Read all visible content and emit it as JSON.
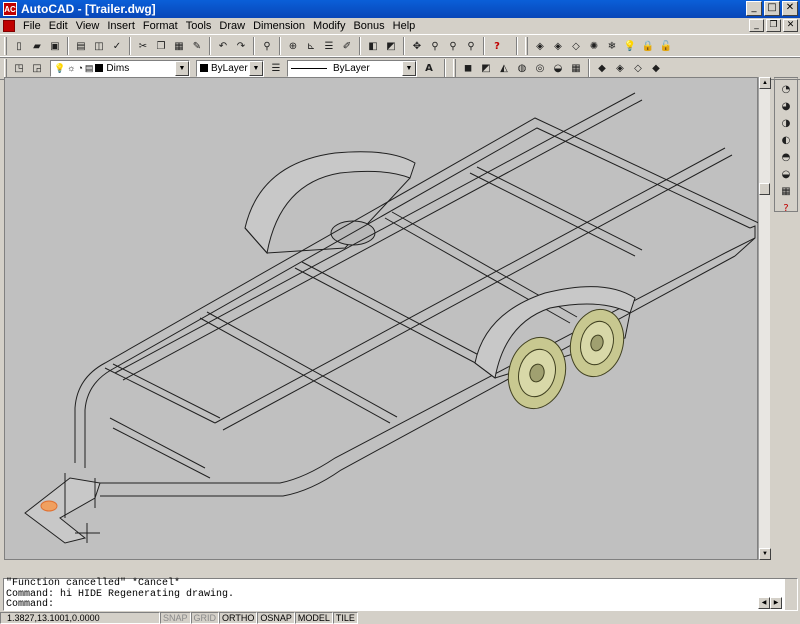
{
  "window": {
    "title": "AutoCAD - [Trailer.dwg]",
    "app_icon_text": "AC"
  },
  "menu": {
    "items": [
      "File",
      "Edit",
      "View",
      "Insert",
      "Format",
      "Tools",
      "Draw",
      "Dimension",
      "Modify",
      "Bonus",
      "Help"
    ]
  },
  "properties": {
    "layer": "Dims",
    "color": "ByLayer",
    "linetype": "ByLayer"
  },
  "command_history": [
    "\"Function cancelled\" *Cancel*",
    "Command: hi HIDE Regenerating drawing.",
    "Command:"
  ],
  "status": {
    "coords": "1.3827,13.1001,0.0000",
    "toggles": [
      {
        "label": "SNAP",
        "on": false
      },
      {
        "label": "GRID",
        "on": false
      },
      {
        "label": "ORTHO",
        "on": true
      },
      {
        "label": "OSNAP",
        "on": true
      },
      {
        "label": "MODEL",
        "on": true
      },
      {
        "label": "TILE",
        "on": true
      }
    ]
  },
  "colors": {
    "title_blue": "#0a5fd8",
    "canvas_bg": "#c0c0c0",
    "wheel": "#c8c890"
  }
}
